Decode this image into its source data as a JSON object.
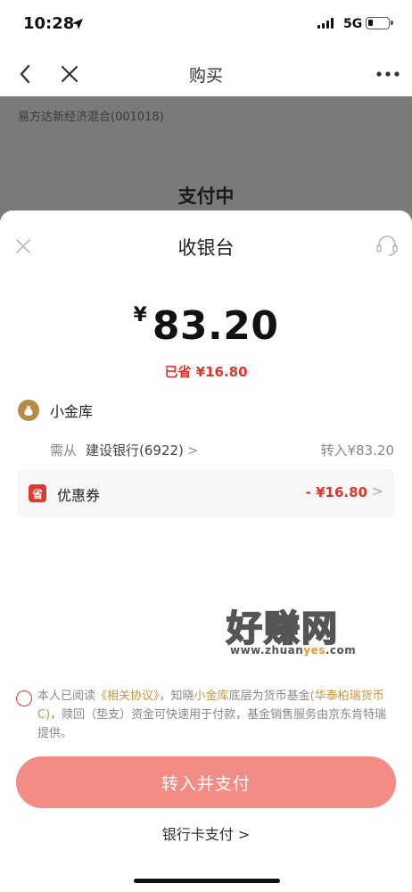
{
  "status_bar": {
    "time": "10:28",
    "network": "5G",
    "icons": [
      "location-arrow-icon",
      "signal-icon",
      "battery-icon"
    ]
  },
  "nav": {
    "title": "购买",
    "back_icon": "chevron-left-icon",
    "close_icon": "close-icon",
    "more_icon": "more-dots-icon"
  },
  "background_page": {
    "fund_name": "易方达新经济混合(001018)",
    "status": "支付中"
  },
  "sheet": {
    "title": "收银台",
    "currency_symbol": "¥",
    "amount": "83.20",
    "saved": "已省 ¥16.80",
    "wallet_name": "小金库",
    "transfer_prefix": "需从",
    "transfer_bank": "建设银行(6922)",
    "transfer_chevron": ">",
    "transfer_amount": "转入¥83.20",
    "coupon_badge": "省",
    "coupon_label": "优惠券",
    "coupon_value": "- ¥16.80",
    "coupon_chevron": ">",
    "agreement": {
      "part1": "本人已阅读",
      "link1": "《相关协议》",
      "part2": "，知晓",
      "link2": "小金库",
      "part3": "底层为货币基金",
      "link3": "(华泰柏瑞货币C)",
      "part4": "，赎回（垫支）资金可快速用于付款，基金销售服务由京东肯特瑞提供。"
    },
    "pay_button": "转入并支付",
    "bank_card_pay": "银行卡支付 >"
  },
  "watermark": {
    "title": "好赚网",
    "url_prefix": "www.zhuan",
    "url_accent": "yes",
    "url_suffix": ".com"
  },
  "colors": {
    "accent_red": "#e0372c",
    "pay_button": "#f48c86",
    "link_gold": "#c8963e",
    "overlay_gray": "#7a7a7a"
  }
}
